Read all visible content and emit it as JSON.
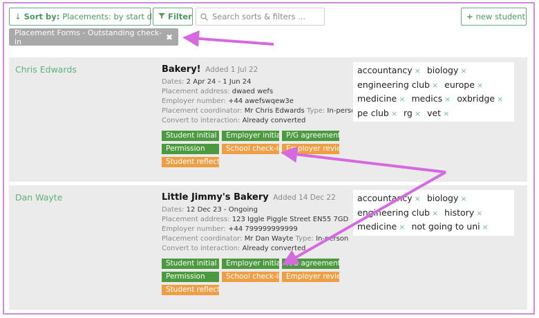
{
  "toolbar": {
    "sort_prefix": "Sort by:",
    "sort_value": "Placements: by start date",
    "filter_label": "Filter",
    "search_placeholder": "Search sorts & filters ...",
    "new_student_label": "new student"
  },
  "active_filter": {
    "label": "Placement Forms - Outstanding check-in",
    "remove_glyph": "✖"
  },
  "placements": [
    {
      "student": "Chris Edwards",
      "title": "Bakery!",
      "added": "Added 1 Jul 22",
      "dates_label": "Dates:",
      "dates": "2 Apr 24 - 1 Jun 24",
      "address_label": "Placement address:",
      "address": "dwaed wefs",
      "employer_label": "Employer number:",
      "employer": "+44 awefswqew3e",
      "coordinator_label": "Placement coordinator:",
      "coordinator": "Mr Chris Edwards",
      "type_label": "Type:",
      "type": "In-person",
      "convert_label": "Convert to interaction:",
      "convert": "Already converted",
      "forms": [
        {
          "label": "Student initial",
          "status": "done"
        },
        {
          "label": "Employer initial",
          "status": "done"
        },
        {
          "label": "P/G agreement",
          "status": "done"
        },
        {
          "label": "Permission",
          "status": "done"
        },
        {
          "label": "School check-in",
          "status": "outstanding"
        },
        {
          "label": "Employer review",
          "status": "outstanding"
        },
        {
          "label": "Student reflection",
          "status": "outstanding"
        }
      ],
      "tags": [
        "accountancy",
        "biology",
        "engineering club",
        "europe",
        "medicine",
        "medics",
        "oxbridge",
        "pe club",
        "rg",
        "vet"
      ]
    },
    {
      "student": "Dan Wayte",
      "title": "Little Jimmy's Bakery",
      "added": "Added 14 Dec 22",
      "dates_label": "Dates:",
      "dates": "12 Dec 23 - Ongoing",
      "address_label": "Placement address:",
      "address": "123 Iggle Piggle Street EN55 7GD",
      "employer_label": "Employer number:",
      "employer": "+44 799999999999",
      "coordinator_label": "Placement coordinator:",
      "coordinator": "Mr Dan Wayte",
      "type_label": "Type:",
      "type": "In-person",
      "convert_label": "Convert to interaction:",
      "convert": "Already converted",
      "forms": [
        {
          "label": "Student initial",
          "status": "done"
        },
        {
          "label": "Employer initial",
          "status": "done"
        },
        {
          "label": "P/G agreement",
          "status": "done"
        },
        {
          "label": "Permission",
          "status": "done"
        },
        {
          "label": "School check-in",
          "status": "outstanding"
        },
        {
          "label": "Employer review",
          "status": "outstanding"
        },
        {
          "label": "Student reflection",
          "status": "outstanding"
        }
      ],
      "tags": [
        "accountancy",
        "biology",
        "engineering club",
        "history",
        "medicine",
        "not going to uni"
      ]
    }
  ],
  "colors": {
    "done": "#4c9a3f",
    "outstanding": "#ee9f45",
    "annotation_arrow": "#d56ae0",
    "student_name": "#5fb07a"
  },
  "icons": {
    "sort": "down-arrow-icon",
    "filter": "funnel-icon",
    "search": "search-icon",
    "add": "plus-icon"
  }
}
